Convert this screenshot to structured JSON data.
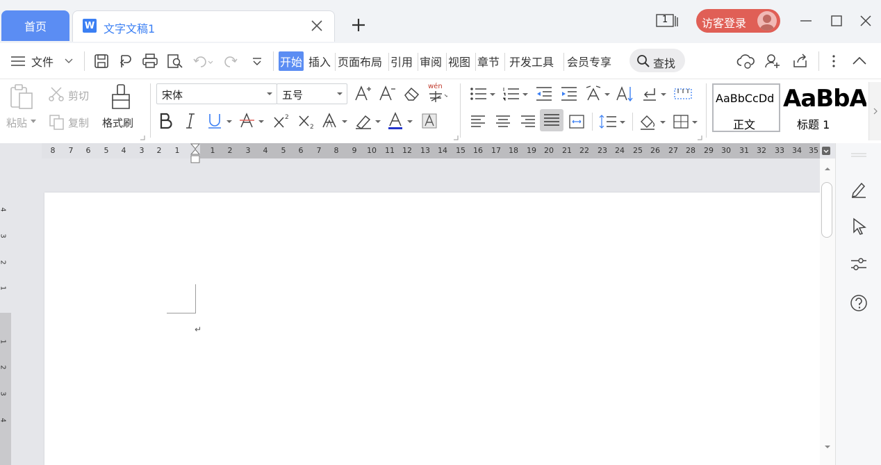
{
  "tabs": {
    "home": "首页",
    "document": "文字文稿1",
    "logo_letter": "W",
    "page_count": "1"
  },
  "account": {
    "login_label": "访客登录"
  },
  "menu": {
    "file": "文件",
    "tabs": [
      "开始",
      "插入",
      "页面布局",
      "引用",
      "审阅",
      "视图",
      "章节",
      "开发工具",
      "会员专享"
    ],
    "search": "查找"
  },
  "ribbon": {
    "paste": "粘贴",
    "cut": "剪切",
    "copy": "复制",
    "format_painter": "格式刷",
    "font_name": "宋体",
    "font_size": "五号",
    "phonetic": "wén",
    "styles": {
      "normal_sample": "AaBbCcDd",
      "normal_name": "正文",
      "heading_sample": "AaBbA",
      "heading_name": "标题 1"
    }
  },
  "ruler": {
    "negative": [
      "8",
      "7",
      "6",
      "5",
      "4",
      "3",
      "2",
      "1"
    ],
    "positive": [
      "1",
      "2",
      "3",
      "4",
      "5",
      "6",
      "7",
      "8",
      "9",
      "10",
      "11",
      "12",
      "13",
      "14",
      "15",
      "16",
      "17",
      "18",
      "19",
      "20",
      "21",
      "22",
      "23",
      "24",
      "25",
      "26",
      "27",
      "28",
      "29",
      "30",
      "31",
      "32",
      "33",
      "34",
      "35"
    ]
  },
  "vertical_ruler": [
    "4",
    "3",
    "2",
    "1",
    "1",
    "2",
    "3",
    "4"
  ],
  "colors": {
    "accent": "#5b8df3",
    "doc_blue": "#3b7ff3",
    "login": "#e05f56"
  },
  "icons": [
    "menu-icon",
    "save-icon",
    "export-icon",
    "print-icon",
    "preview-icon",
    "undo-icon",
    "redo-icon",
    "more-icon",
    "cloud-icon",
    "share-user-icon",
    "share-icon",
    "kebab-icon",
    "collapse-icon",
    "edit-icon",
    "select-icon",
    "settings-icon",
    "help-icon"
  ]
}
